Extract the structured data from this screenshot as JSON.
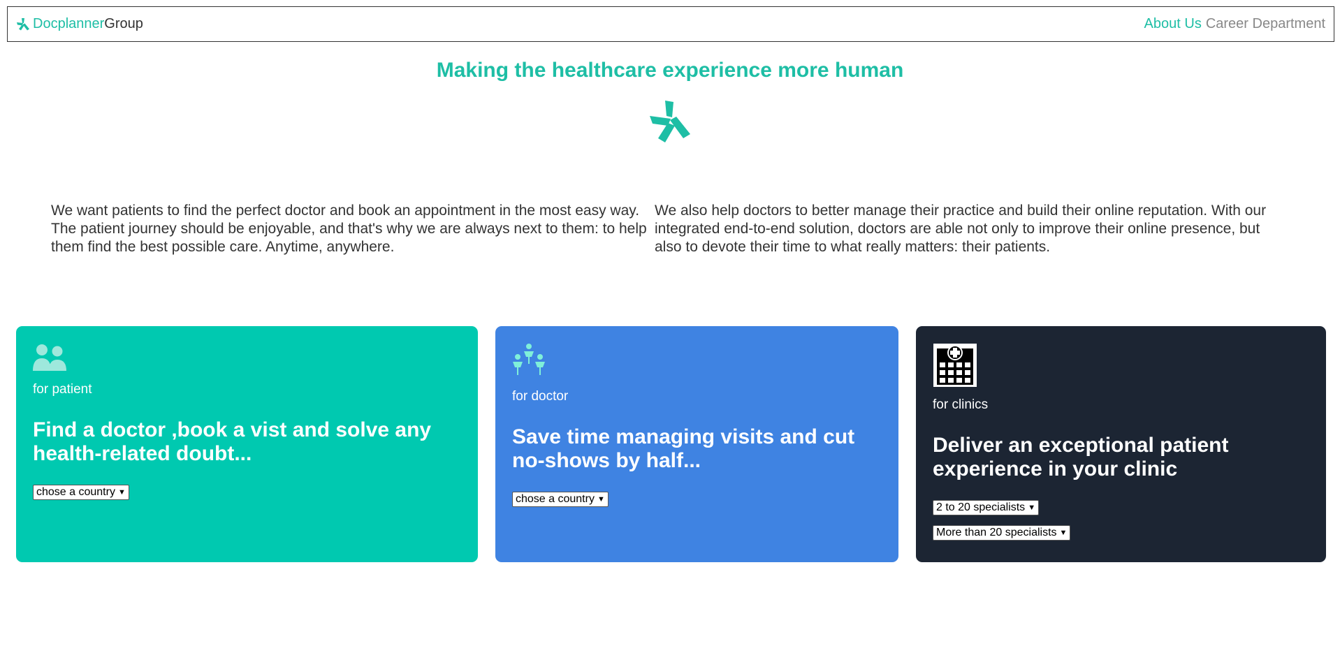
{
  "header": {
    "brand_part1": "Docplanner",
    "brand_part2": "Group",
    "nav_about": "About Us",
    "nav_career": "Career Department"
  },
  "hero": {
    "title": "Making the healthcare experience more human",
    "logo_icon": "docplanner-star-icon"
  },
  "intro": {
    "left": "We want patients to find the perfect doctor and book an appointment in the most easy way. The patient journey should be enjoyable, and that's why we are always next to them: to help them find the best possible care. Anytime, anywhere.",
    "right": "We also help doctors to better manage their practice and build their online reputation. With our integrated end-to-end solution, doctors are able not only to improve their online presence, but also to devote their time to what really matters: their patients."
  },
  "cards": {
    "patient": {
      "icon": "users-icon",
      "subtitle": "for patient",
      "heading": "Find a doctor ,book a vist and solve any health-related doubt...",
      "select": "chose a country",
      "color": "#00c9b0"
    },
    "doctor": {
      "icon": "doctors-icon",
      "subtitle": "for doctor",
      "heading": "Save time managing visits and cut no-shows by half...",
      "select": "chose a country",
      "color": "#3f83e2"
    },
    "clinic": {
      "icon": "hospital-icon",
      "subtitle": "for clinics",
      "heading": "Deliver an exceptional patient experience in your clinic",
      "select1": "2 to 20 specialists",
      "select2": "More than 20 specialists",
      "color": "#1c2533"
    }
  },
  "colors": {
    "accent": "#1ebea5"
  }
}
